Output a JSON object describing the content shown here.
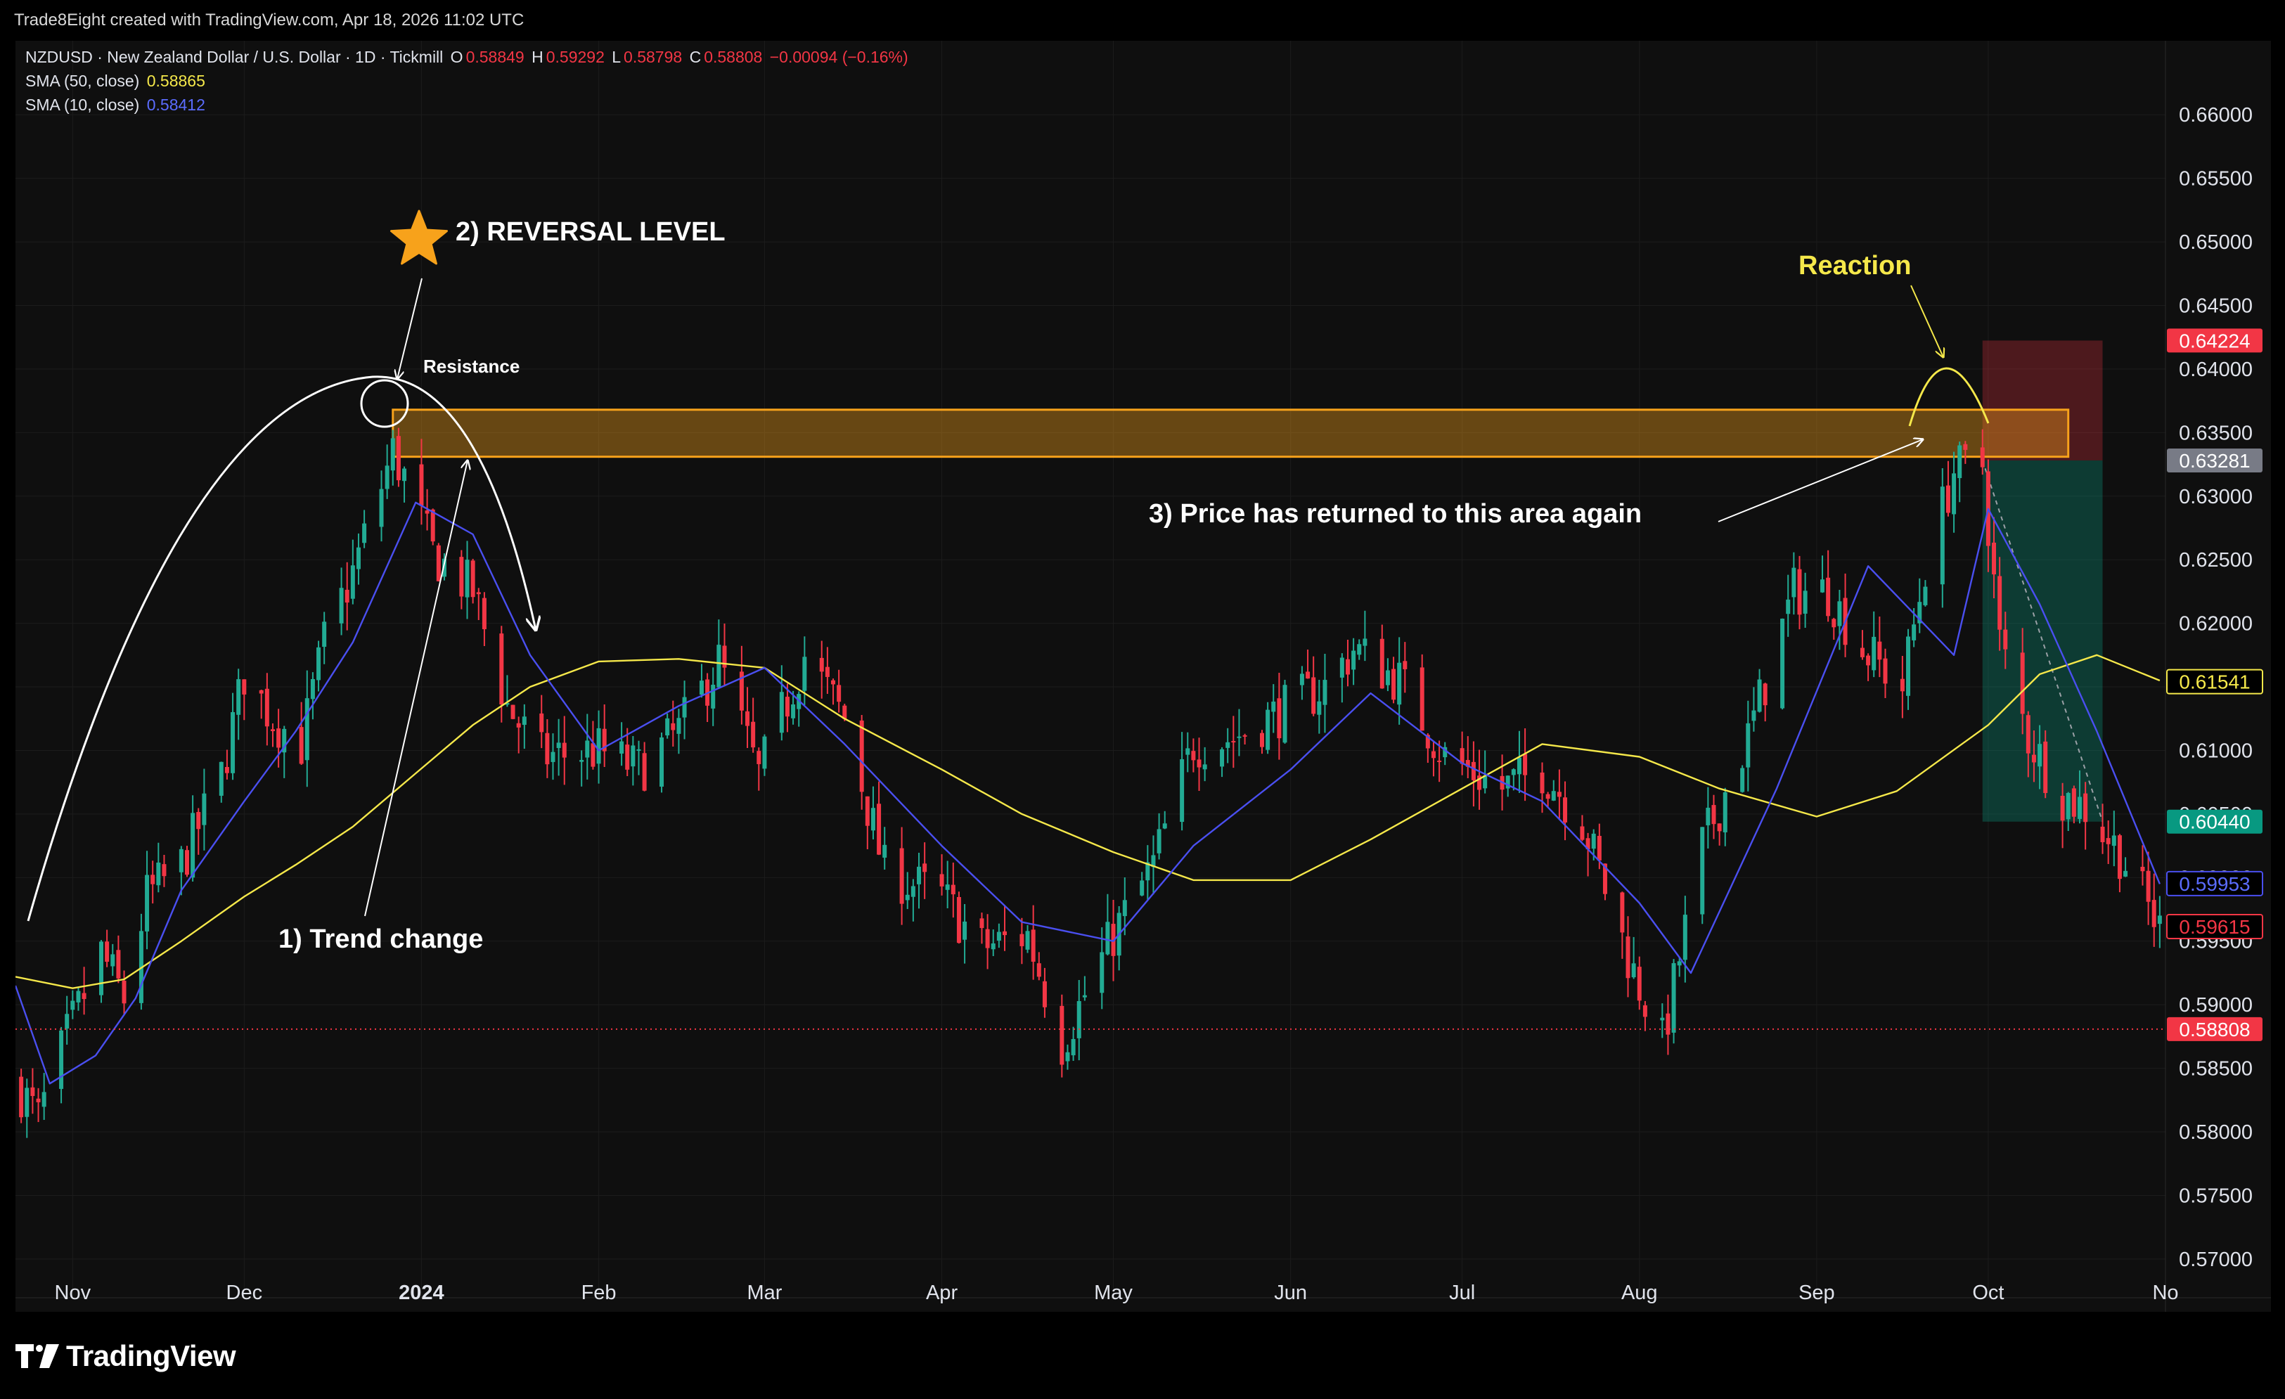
{
  "header": {
    "created_text": "Trade8Eight created with TradingView.com, Apr 18, 2026 11:02 UTC"
  },
  "legend": {
    "symbol_line": "NZDUSD · New Zealand Dollar / U.S. Dollar · 1D · Tickmill",
    "o_label": "O",
    "o_value": "0.58849",
    "h_label": "H",
    "h_value": "0.59292",
    "l_label": "L",
    "l_value": "0.58798",
    "c_label": "C",
    "c_value": "0.58808",
    "change": "−0.00094 (−0.16%)",
    "sma50_label": "SMA (50, close)",
    "sma50_value": "0.58865",
    "sma10_label": "SMA (10, close)",
    "sma10_value": "0.58412"
  },
  "footer": {
    "brand": "TradingView"
  },
  "colors": {
    "up": "#22ab94",
    "down": "#f23645",
    "sma50": "#f5e84a",
    "sma10": "#4a4ff0",
    "zone_fill": "#f7a21b",
    "zone_border": "#f7a21b",
    "grid": "#1c1c1c"
  },
  "annotations": {
    "reversal": "2) REVERSAL LEVEL",
    "resistance": "Resistance",
    "trend_change": "1) Trend change",
    "reaction": "Reaction",
    "returned": "3) Price has returned to this area again"
  },
  "chart_data": {
    "type": "candlestick",
    "symbol": "NZDUSD",
    "timeframe": "1D",
    "y_ticks": [
      "0.66000",
      "0.65500",
      "0.65000",
      "0.64500",
      "0.64000",
      "0.63500",
      "0.63000",
      "0.62500",
      "0.62000",
      "0.61500",
      "0.61000",
      "0.60500",
      "0.60000",
      "0.59500",
      "0.59000",
      "0.58500",
      "0.58000",
      "0.57500",
      "0.57000"
    ],
    "ylim": [
      0.5685,
      0.6625
    ],
    "x_ticks": [
      {
        "label": "Nov",
        "date": "2023-11-01"
      },
      {
        "label": "Dec",
        "date": "2023-12-01"
      },
      {
        "label": "2024",
        "date": "2024-01-01"
      },
      {
        "label": "Feb",
        "date": "2024-02-01"
      },
      {
        "label": "Mar",
        "date": "2024-03-01"
      },
      {
        "label": "Apr",
        "date": "2024-04-01"
      },
      {
        "label": "May",
        "date": "2024-05-01"
      },
      {
        "label": "Jun",
        "date": "2024-06-01"
      },
      {
        "label": "Jul",
        "date": "2024-07-01"
      },
      {
        "label": "Aug",
        "date": "2024-08-01"
      },
      {
        "label": "Sep",
        "date": "2024-09-01"
      },
      {
        "label": "Oct",
        "date": "2024-10-01"
      },
      {
        "label": "No",
        "date": "2024-11-01"
      }
    ],
    "xlim": [
      "2023-10-22",
      "2024-11-01"
    ],
    "price_tags": [
      {
        "label": "0.64224",
        "value": 0.64224,
        "bg": "#f23645",
        "fg": "#ffffff"
      },
      {
        "label": "0.63281",
        "value": 0.63281,
        "bg": "#787b86",
        "fg": "#ffffff"
      },
      {
        "label": "0.61541",
        "value": 0.61541,
        "bg": "#000000",
        "fg": "#f5e84a",
        "border": "#f5e84a"
      },
      {
        "label": "0.60440",
        "value": 0.6044,
        "bg": "#089981",
        "fg": "#ffffff"
      },
      {
        "label": "0.59953",
        "value": 0.59953,
        "bg": "#000000",
        "fg": "#5b6cff",
        "border": "#4a4ff0"
      },
      {
        "label": "0.59615",
        "value": 0.59615,
        "bg": "#000000",
        "fg": "#f23645",
        "border": "#f23645"
      },
      {
        "label": "0.58808",
        "value": 0.58808,
        "bg": "#f23645",
        "fg": "#ffffff"
      }
    ],
    "last_price": 0.58808,
    "resistance_zone": {
      "from": "2023-12-27",
      "to": "2024-10-15",
      "low": 0.6331,
      "high": 0.6368
    },
    "position_box": {
      "from": "2024-09-30",
      "to": "2024-10-21",
      "entry": 0.63281,
      "stop": 0.64224,
      "target": 0.6044
    },
    "sma50": [
      [
        "2023-10-22",
        0.5922
      ],
      [
        "2023-11-01",
        0.5913
      ],
      [
        "2023-11-10",
        0.592
      ],
      [
        "2023-11-20",
        0.595
      ],
      [
        "2023-12-01",
        0.5985
      ],
      [
        "2023-12-10",
        0.601
      ],
      [
        "2023-12-20",
        0.604
      ],
      [
        "2023-12-31",
        0.6082
      ],
      [
        "2024-01-10",
        0.612
      ],
      [
        "2024-01-20",
        0.615
      ],
      [
        "2024-02-01",
        0.617
      ],
      [
        "2024-02-15",
        0.6172
      ],
      [
        "2024-03-01",
        0.6165
      ],
      [
        "2024-03-15",
        0.6125
      ],
      [
        "2024-04-01",
        0.6085
      ],
      [
        "2024-04-15",
        0.605
      ],
      [
        "2024-05-01",
        0.602
      ],
      [
        "2024-05-15",
        0.5998
      ],
      [
        "2024-06-01",
        0.5998
      ],
      [
        "2024-06-15",
        0.603
      ],
      [
        "2024-07-01",
        0.607
      ],
      [
        "2024-07-15",
        0.6105
      ],
      [
        "2024-08-01",
        0.6095
      ],
      [
        "2024-08-15",
        0.607
      ],
      [
        "2024-09-01",
        0.6048
      ],
      [
        "2024-09-15",
        0.6068
      ],
      [
        "2024-10-01",
        0.612
      ],
      [
        "2024-10-10",
        0.616
      ],
      [
        "2024-10-20",
        0.6175
      ],
      [
        "2024-10-31",
        0.6155
      ]
    ],
    "sma10": [
      [
        "2023-10-22",
        0.5915
      ],
      [
        "2023-10-28",
        0.5838
      ],
      [
        "2023-11-05",
        0.586
      ],
      [
        "2023-11-12",
        0.5905
      ],
      [
        "2023-11-20",
        0.599
      ],
      [
        "2023-12-01",
        0.606
      ],
      [
        "2023-12-10",
        0.6115
      ],
      [
        "2023-12-20",
        0.6185
      ],
      [
        "2023-12-31",
        0.6295
      ],
      [
        "2024-01-10",
        0.627
      ],
      [
        "2024-01-20",
        0.6175
      ],
      [
        "2024-02-01",
        0.61
      ],
      [
        "2024-02-15",
        0.6135
      ],
      [
        "2024-03-01",
        0.6165
      ],
      [
        "2024-03-15",
        0.6105
      ],
      [
        "2024-04-01",
        0.6025
      ],
      [
        "2024-04-15",
        0.5965
      ],
      [
        "2024-05-01",
        0.595
      ],
      [
        "2024-05-15",
        0.6025
      ],
      [
        "2024-06-01",
        0.6085
      ],
      [
        "2024-06-15",
        0.6145
      ],
      [
        "2024-07-01",
        0.609
      ],
      [
        "2024-07-15",
        0.606
      ],
      [
        "2024-08-01",
        0.598
      ],
      [
        "2024-08-10",
        0.5925
      ],
      [
        "2024-08-25",
        0.607
      ],
      [
        "2024-09-10",
        0.6245
      ],
      [
        "2024-09-25",
        0.6175
      ],
      [
        "2024-10-01",
        0.629
      ],
      [
        "2024-10-10",
        0.6215
      ],
      [
        "2024-10-20",
        0.6115
      ],
      [
        "2024-10-31",
        0.5995
      ]
    ],
    "price_path": [
      [
        "2023-10-22",
        0.584
      ],
      [
        "2023-10-26",
        0.581
      ],
      [
        "2023-10-31",
        0.5875
      ],
      [
        "2023-11-06",
        0.594
      ],
      [
        "2023-11-10",
        0.5905
      ],
      [
        "2023-11-14",
        0.5985
      ],
      [
        "2023-11-20",
        0.601
      ],
      [
        "2023-11-27",
        0.608
      ],
      [
        "2023-12-01",
        0.616
      ],
      [
        "2023-12-06",
        0.6125
      ],
      [
        "2023-12-11",
        0.6105
      ],
      [
        "2023-12-15",
        0.6185
      ],
      [
        "2023-12-20",
        0.624
      ],
      [
        "2023-12-27",
        0.6335
      ],
      [
        "2023-12-29",
        0.6315
      ],
      [
        "2024-01-03",
        0.6255
      ],
      [
        "2024-01-10",
        0.6225
      ],
      [
        "2024-01-16",
        0.6135
      ],
      [
        "2024-01-22",
        0.6095
      ],
      [
        "2024-02-01",
        0.61
      ],
      [
        "2024-02-08",
        0.6085
      ],
      [
        "2024-02-15",
        0.6115
      ],
      [
        "2024-02-22",
        0.617
      ],
      [
        "2024-02-29",
        0.608
      ],
      [
        "2024-03-08",
        0.6175
      ],
      [
        "2024-03-15",
        0.6125
      ],
      [
        "2024-03-22",
        0.6005
      ],
      [
        "2024-04-01",
        0.5985
      ],
      [
        "2024-04-08",
        0.5945
      ],
      [
        "2024-04-16",
        0.5955
      ],
      [
        "2024-04-22",
        0.587
      ],
      [
        "2024-05-01",
        0.5955
      ],
      [
        "2024-05-08",
        0.601
      ],
      [
        "2024-05-15",
        0.6105
      ],
      [
        "2024-05-22",
        0.611
      ],
      [
        "2024-06-01",
        0.6135
      ],
      [
        "2024-06-07",
        0.615
      ],
      [
        "2024-06-12",
        0.618
      ],
      [
        "2024-06-20",
        0.6155
      ],
      [
        "2024-06-28",
        0.6095
      ],
      [
        "2024-07-08",
        0.607
      ],
      [
        "2024-07-15",
        0.6085
      ],
      [
        "2024-07-22",
        0.6045
      ],
      [
        "2024-07-31",
        0.5925
      ],
      [
        "2024-08-05",
        0.587
      ],
      [
        "2024-08-12",
        0.6025
      ],
      [
        "2024-08-20",
        0.611
      ],
      [
        "2024-08-28",
        0.6225
      ],
      [
        "2024-09-03",
        0.6225
      ],
      [
        "2024-09-09",
        0.618
      ],
      [
        "2024-09-16",
        0.615
      ],
      [
        "2024-09-20",
        0.6245
      ],
      [
        "2024-09-25",
        0.632
      ],
      [
        "2024-09-30",
        0.6325
      ],
      [
        "2024-10-03",
        0.6185
      ],
      [
        "2024-10-08",
        0.611
      ],
      [
        "2024-10-14",
        0.6065
      ],
      [
        "2024-10-18",
        0.6055
      ],
      [
        "2024-10-24",
        0.602
      ],
      [
        "2024-10-31",
        0.596
      ]
    ]
  }
}
